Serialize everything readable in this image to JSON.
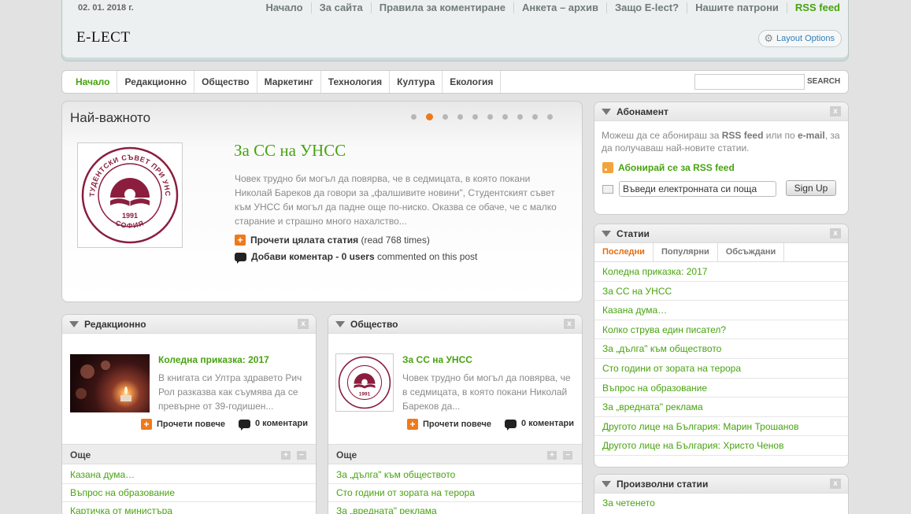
{
  "header": {
    "date": "02. 01. 2018 г.",
    "logo": "E-LECT",
    "top_nav": [
      "Начало",
      "За сайта",
      "Правила за коментиране",
      "Анкета – архив",
      "Защо E-lect?",
      "Нашите патрони",
      "RSS feed"
    ],
    "layout_options": "Layout Options"
  },
  "main_nav": {
    "items": [
      "Начало",
      "Редакционно",
      "Общество",
      "Маркетинг",
      "Технология",
      "Култура",
      "Екология"
    ],
    "search_button": "SEARCH",
    "search_value": ""
  },
  "featured": {
    "heading": "Най-важното",
    "slides_total": 10,
    "active_slide": 2,
    "logo_text_top": "СТУДЕНТСКИ СЪВЕТ ПРИ УНСС",
    "logo_year": "1991",
    "logo_city": "СОФИЯ",
    "title": "За СС на УНСС",
    "text": "Човек трудно би могъл да повярва, че в седмицата, в която покани Николай Бареков да говори за „фалшивите новини\", Студентският съвет към УНСС би могъл да падне още по-ниско. Оказва се обаче, че с малко старание и страшно много нахалство...",
    "read_full": "Прочети цялата статия",
    "read_count": "(read 768 times)",
    "add_comment": "Добави коментар",
    "dash": "-",
    "users": "0 users",
    "commented": "commented on this post"
  },
  "redaction": {
    "title": "Редакционно",
    "post_title": "Коледна приказка: 2017",
    "post_text": "В книгата си Ултра здравето Рич Рол разказва как съумява да се превърне от 39-годишен...",
    "read_more": "Прочети повече",
    "comments": "0 коментари",
    "more_heading": "Още",
    "more_items": [
      "Казана дума…",
      "Въпрос на образование",
      "Картичка от министъра"
    ]
  },
  "society": {
    "title": "Общество",
    "post_title": "За СС на УНСС",
    "post_text": "Човек трудно би могъл да повярва, че в седмицата, в която покани Николай Бареков да...",
    "read_more": "Прочети повече",
    "comments": "0 коментари",
    "more_heading": "Още",
    "more_items": [
      "За „дълга\" към обществото",
      "Сто години от зората на терора",
      "За „вредната\" реклама"
    ]
  },
  "subscribe": {
    "title": "Абонамент",
    "text_a": "Можеш да се абонираш за ",
    "text_rss": "RSS feed",
    "text_b": " или по ",
    "text_email": "e-mail",
    "text_c": ", за да получаваш най-новите статии.",
    "rss_link": "Абонирай се за RSS feed",
    "email_value": "Въведи електронната си поща",
    "signup": "Sign Up"
  },
  "articles": {
    "title": "Статии",
    "tabs": [
      "Последни",
      "Популярни",
      "Обсъждани"
    ],
    "items": [
      "Коледна приказка: 2017",
      "За СС на УНСС",
      "Казана дума…",
      "Колко струва един писател?",
      "За „дълга\" към обществото",
      "Сто години от зората на терора",
      "Въпрос на образование",
      "За „вредната\" реклама",
      "Другото лице на България: Марин Трошанов",
      "Другото лице на България: Христо Ченов"
    ]
  },
  "random": {
    "title": "Произволни статии",
    "item": "За четенето"
  },
  "colors": {
    "accent_green": "#48a310",
    "accent_orange": "#ee7a1b",
    "logo_maroon": "#8b1e3f"
  }
}
